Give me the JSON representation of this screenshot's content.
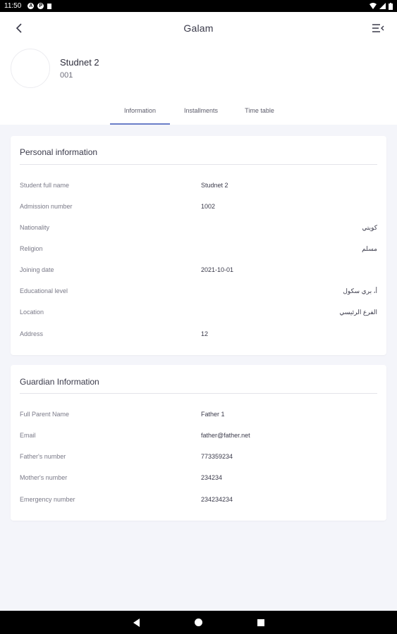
{
  "status_bar": {
    "time": "11:50"
  },
  "header": {
    "title": "Galam"
  },
  "profile": {
    "name": "Studnet 2",
    "id": "001"
  },
  "tabs": [
    {
      "label": "Information",
      "active": true
    },
    {
      "label": "Installments",
      "active": false
    },
    {
      "label": "Time table",
      "active": false
    }
  ],
  "personal": {
    "title": "Personal information",
    "rows": [
      {
        "label": "Student full name",
        "value": "Studnet 2"
      },
      {
        "label": "Admission number",
        "value": "1002"
      },
      {
        "label": "Nationality",
        "value": "كويتي"
      },
      {
        "label": "Religion",
        "value": "مسلم"
      },
      {
        "label": "Joining date",
        "value": "2021-10-01"
      },
      {
        "label": "Educational level",
        "value": "أ، بري سكول"
      },
      {
        "label": "Location",
        "value": "الفرع الرئيسي"
      },
      {
        "label": "Address",
        "value": "12"
      }
    ]
  },
  "guardian": {
    "title": "Guardian Information",
    "rows": [
      {
        "label": "Full Parent Name",
        "value": "Father 1"
      },
      {
        "label": "Email",
        "value": "father@father.net"
      },
      {
        "label": "Father's number",
        "value": "773359234"
      },
      {
        "label": "Mother's number",
        "value": "234234"
      },
      {
        "label": "Emergency number",
        "value": "234234234"
      }
    ]
  },
  "colors": {
    "accent": "#6a7ec8",
    "background": "#f4f5fa"
  }
}
